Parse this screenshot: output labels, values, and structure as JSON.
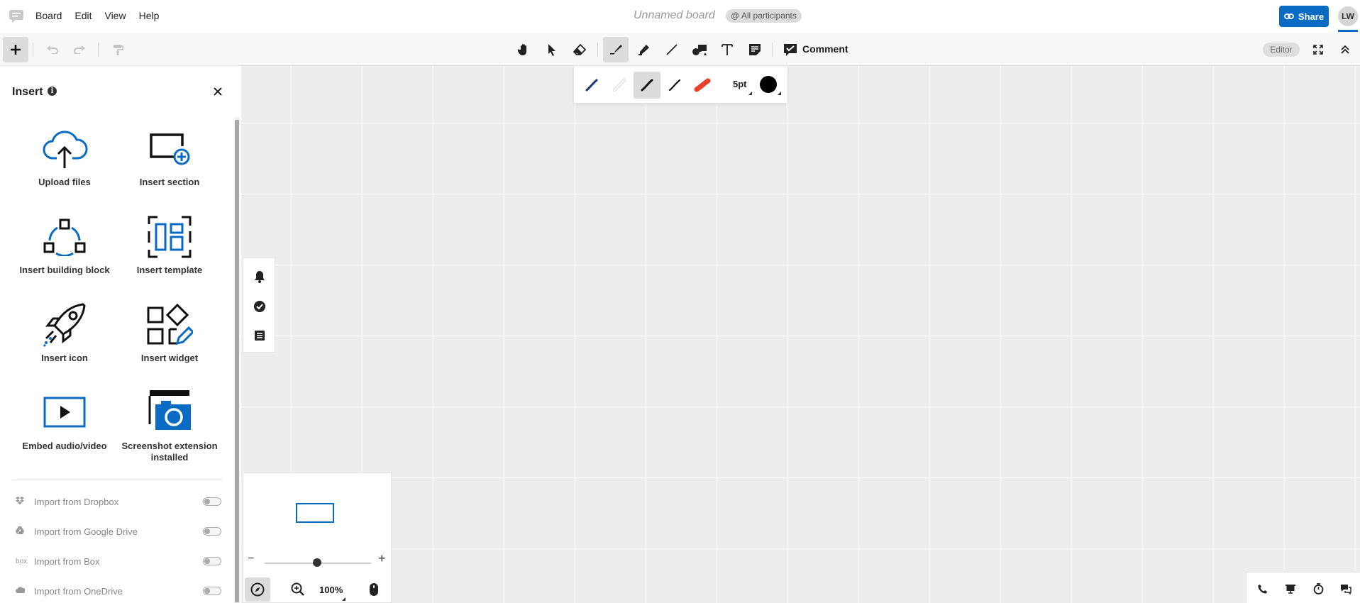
{
  "menubar": {
    "items": [
      "Board",
      "Edit",
      "View",
      "Help"
    ],
    "board_title": "Unnamed board",
    "participants_badge": "@ All participants",
    "share_label": "Share",
    "avatar_initials": "LW",
    "accent_color": "#0a6bc4"
  },
  "toolbar": {
    "comment_label": "Comment",
    "role_badge": "Editor",
    "tools": [
      "hand-icon",
      "pointer-icon",
      "eraser-icon",
      "pen-icon",
      "highlighter-icon",
      "line-icon",
      "shapes-icon",
      "text-icon",
      "sticky-note-icon",
      "comment-icon"
    ],
    "active_tool": "pen-icon"
  },
  "pen_options": {
    "size_label": "5pt",
    "color": "#000000",
    "styles": [
      "blue-pen",
      "light-pen",
      "black-pen",
      "thin-pen",
      "red-marker"
    ],
    "active_style": "black-pen"
  },
  "insert_panel": {
    "title": "Insert",
    "tiles": [
      {
        "label": "Upload files",
        "icon": "upload-cloud-icon"
      },
      {
        "label": "Insert section",
        "icon": "section-add-icon"
      },
      {
        "label": "Insert building block",
        "icon": "building-block-icon"
      },
      {
        "label": "Insert template",
        "icon": "template-icon"
      },
      {
        "label": "Insert icon",
        "icon": "rocket-icon"
      },
      {
        "label": "Insert widget",
        "icon": "widget-icon"
      },
      {
        "label": "Embed audio/video",
        "icon": "video-icon"
      },
      {
        "label": "Screenshot extension installed",
        "icon": "camera-icon"
      }
    ],
    "imports": [
      {
        "label": "Import from Dropbox",
        "icon": "dropbox-icon",
        "enabled": false
      },
      {
        "label": "Import from Google Drive",
        "icon": "google-drive-icon",
        "enabled": false
      },
      {
        "label": "Import from Box",
        "icon": "box-icon",
        "enabled": false,
        "icon_text": "box"
      },
      {
        "label": "Import from OneDrive",
        "icon": "onedrive-icon",
        "enabled": false
      }
    ]
  },
  "navigator": {
    "zoom_label": "100%",
    "zoom_minus": "−",
    "zoom_plus": "+"
  }
}
